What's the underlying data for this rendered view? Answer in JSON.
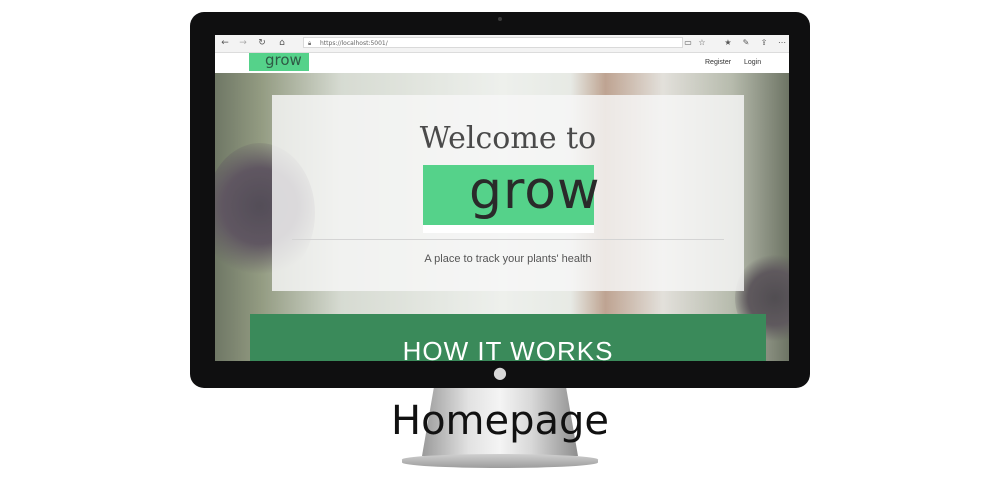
{
  "browser": {
    "url": "https://localhost:5001/",
    "nav_icons": [
      "back-icon",
      "forward-icon",
      "refresh-icon",
      "home-icon"
    ],
    "toolbar_icons": [
      "reading-view-icon",
      "favorite-star-icon",
      "favorites-hub-icon",
      "pen-icon",
      "share-icon",
      "more-icon"
    ]
  },
  "site": {
    "logo_text": "grow",
    "nav": {
      "register": "Register",
      "login": "Login"
    }
  },
  "hero": {
    "heading": "Welcome to",
    "logo_text": "grow",
    "tagline": "A place to track your plants' health"
  },
  "section": {
    "title": "HOW IT WORKS"
  },
  "caption": "Homepage",
  "colors": {
    "brand_green": "#55d28a",
    "section_green": "#3a8a5a"
  }
}
